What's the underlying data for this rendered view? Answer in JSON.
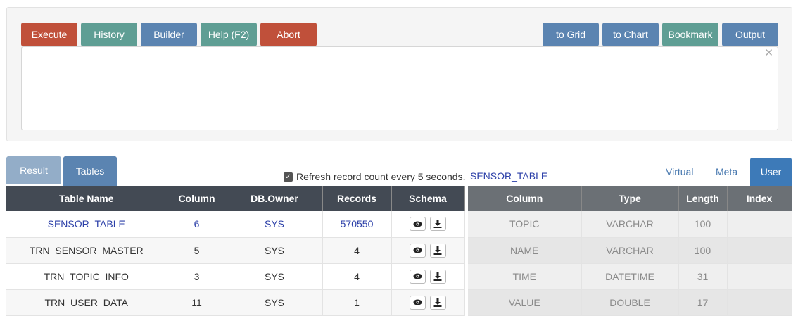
{
  "toolbar": {
    "execute": "Execute",
    "history": "History",
    "builder": "Builder",
    "help": "Help (F2)",
    "abort": "Abort",
    "to_grid": "to Grid",
    "to_chart": "to Chart",
    "bookmark": "Bookmark",
    "output": "Output"
  },
  "editor": {
    "close_symbol": "✕"
  },
  "tabs": {
    "result": "Result",
    "tables": "Tables"
  },
  "refresh": {
    "checked": true,
    "label": "Refresh record count every 5 seconds."
  },
  "selected_table": "SENSOR_TABLE",
  "meta_tabs": {
    "virtual": "Virtual",
    "meta": "Meta",
    "user": "User"
  },
  "tables_grid": {
    "headers": [
      "Table Name",
      "Column",
      "DB.Owner",
      "Records",
      "Schema"
    ],
    "rows": [
      {
        "name": "SENSOR_TABLE",
        "column": "6",
        "owner": "SYS",
        "records": "570550"
      },
      {
        "name": "TRN_SENSOR_MASTER",
        "column": "5",
        "owner": "SYS",
        "records": "4"
      },
      {
        "name": "TRN_TOPIC_INFO",
        "column": "3",
        "owner": "SYS",
        "records": "4"
      },
      {
        "name": "TRN_USER_DATA",
        "column": "11",
        "owner": "SYS",
        "records": "1"
      }
    ]
  },
  "columns_grid": {
    "headers": [
      "Column",
      "Type",
      "Length",
      "Index"
    ],
    "rows": [
      {
        "column": "TOPIC",
        "type": "VARCHAR",
        "length": "100",
        "index": ""
      },
      {
        "column": "NAME",
        "type": "VARCHAR",
        "length": "100",
        "index": ""
      },
      {
        "column": "TIME",
        "type": "DATETIME",
        "length": "31",
        "index": ""
      },
      {
        "column": "VALUE",
        "type": "DOUBLE",
        "length": "17",
        "index": ""
      }
    ]
  },
  "icons": {
    "view": "eye-icon",
    "download": "download-icon"
  },
  "colors": {
    "red": "#c0503a",
    "teal": "#5f9e94",
    "blue": "#5b84b1",
    "link": "#2b3fa8"
  }
}
